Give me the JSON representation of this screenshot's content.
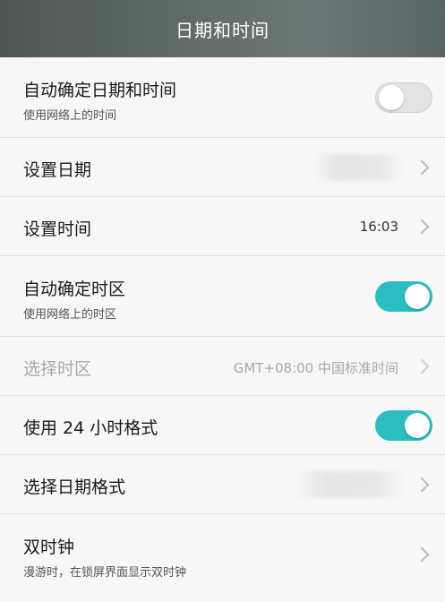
{
  "header": {
    "title": "日期和时间"
  },
  "settings": {
    "auto_datetime": {
      "title": "自动确定日期和时间",
      "subtitle": "使用网络上的时间",
      "enabled": false
    },
    "set_date": {
      "title": "设置日期"
    },
    "set_time": {
      "title": "设置时间",
      "value": "16:03"
    },
    "auto_timezone": {
      "title": "自动确定时区",
      "subtitle": "使用网络上的时区",
      "enabled": true
    },
    "select_timezone": {
      "title": "选择时区",
      "value": "GMT+08:00 中国标准时间",
      "disabled": true
    },
    "use_24h": {
      "title": "使用 24 小时格式",
      "enabled": true
    },
    "date_format": {
      "title": "选择日期格式"
    },
    "dual_clock": {
      "title": "双时钟",
      "subtitle": "漫游时，在锁屏界面显示双时钟"
    }
  },
  "colors": {
    "toggle_on": "#2bbdbf",
    "toggle_off": "#e3e3e3",
    "header_bg": "#5f6a67"
  },
  "icons": {
    "chevron": "chevron-right-icon"
  }
}
